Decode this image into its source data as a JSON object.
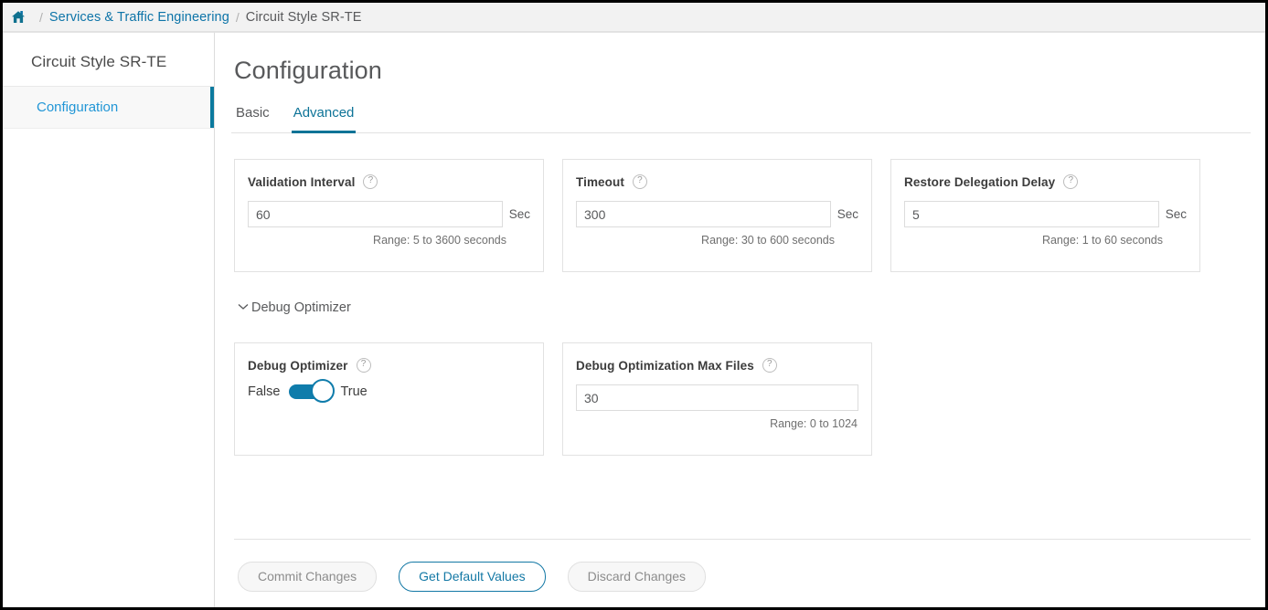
{
  "breadcrumb": {
    "home_icon": "home-icon",
    "separator": "/",
    "items": [
      {
        "label": "Services & Traffic Engineering",
        "link": true
      },
      {
        "label": "Circuit Style SR-TE",
        "link": false
      }
    ]
  },
  "sidebar": {
    "title": "Circuit Style SR-TE",
    "items": [
      {
        "label": "Configuration",
        "active": true
      }
    ]
  },
  "main": {
    "title": "Configuration",
    "tabs": [
      {
        "label": "Basic",
        "active": false
      },
      {
        "label": "Advanced",
        "active": true
      }
    ]
  },
  "cards": [
    {
      "label": "Validation Interval",
      "help_icon": "help-circle-icon",
      "value": "60",
      "unit": "Sec",
      "range": "Range: 5 to 3600 seconds"
    },
    {
      "label": "Timeout",
      "help_icon": "help-circle-icon",
      "value": "300",
      "unit": "Sec",
      "range": "Range: 30 to 600 seconds"
    },
    {
      "label": "Restore Delegation Delay",
      "help_icon": "help-circle-icon",
      "value": "5",
      "unit": "Sec",
      "range": "Range: 1 to 60 seconds"
    }
  ],
  "debug_section": {
    "chevron_icon": "chevron-down-icon",
    "title": "Debug Optimizer",
    "toggle_card": {
      "label": "Debug Optimizer",
      "help_icon": "help-circle-icon",
      "off_label": "False",
      "on_label": "True",
      "state": "True"
    },
    "max_files_card": {
      "label": "Debug Optimization Max Files",
      "help_icon": "help-circle-icon",
      "value": "30",
      "range": "Range: 0 to 1024"
    }
  },
  "footer": {
    "buttons": [
      {
        "label": "Commit Changes",
        "style": "disabled"
      },
      {
        "label": "Get Default Values",
        "style": "primary-outline"
      },
      {
        "label": "Discard Changes",
        "style": "disabled"
      }
    ]
  },
  "colors": {
    "accent_blue": "#0d7397",
    "link_blue": "#0d74a8",
    "sidebar_link": "#2196d6",
    "toggle_on": "#0f7cab",
    "text": "#58595b",
    "breadcrumb_bg": "#f2f2f2"
  }
}
